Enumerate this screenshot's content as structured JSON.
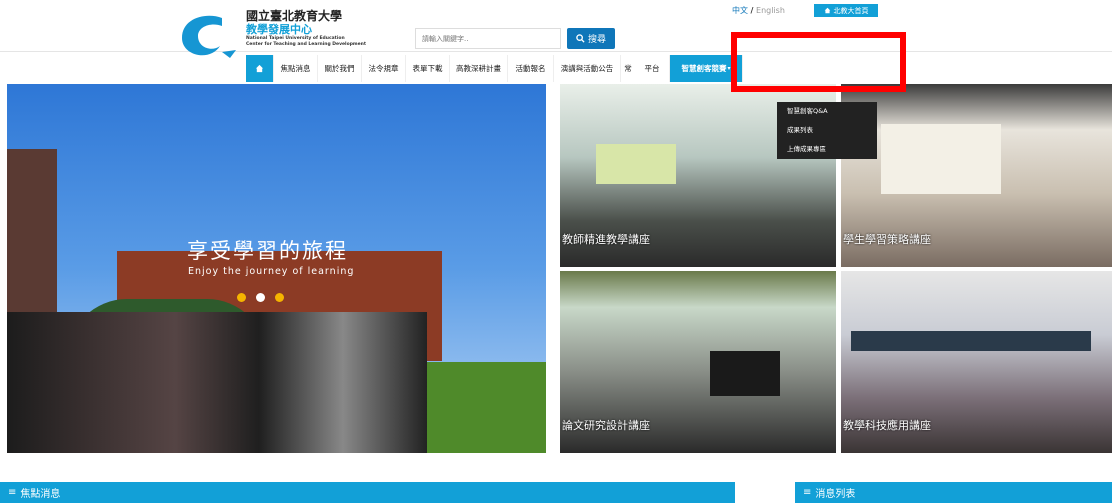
{
  "header": {
    "logo_title": "國立臺北教育大學",
    "logo_subtitle": "教學發展中心",
    "logo_en_1": "National Taipei University of Education",
    "logo_en_2": "Center for Teaching and Learning Development",
    "search_placeholder": "請輸入關鍵字..",
    "search_button": "搜尋",
    "lang_zh": "中文",
    "lang_sep": "/",
    "lang_en": "English",
    "home_link": "北教大首頁"
  },
  "nav": {
    "items": [
      {
        "label": "焦點消息"
      },
      {
        "label": "關於我們"
      },
      {
        "label": "法令規章"
      },
      {
        "label": "表單下載"
      },
      {
        "label": "高教深耕計畫"
      },
      {
        "label": "活動報名"
      },
      {
        "label": "演講與活動公告"
      },
      {
        "label": "常"
      },
      {
        "label": "平台"
      },
      {
        "label": "智慧創客競賽"
      }
    ],
    "dropdown": [
      {
        "label": "智慧創客Q&A"
      },
      {
        "label": "成果列表"
      },
      {
        "label": "上傳成果專區"
      }
    ]
  },
  "hero": {
    "title": "享受學習的旅程",
    "subtitle": "Enjoy the journey of learning"
  },
  "tiles": [
    {
      "label": "教師精進教學講座"
    },
    {
      "label": "學生學習策略講座"
    },
    {
      "label": "論文研究設計講座"
    },
    {
      "label": "教學科技應用講座"
    }
  ],
  "sections": {
    "news": "焦點消息",
    "list": "消息列表"
  },
  "colors": {
    "accent": "#12a0d7",
    "search_button": "#0f76b9",
    "highlight": "#ff0000"
  }
}
